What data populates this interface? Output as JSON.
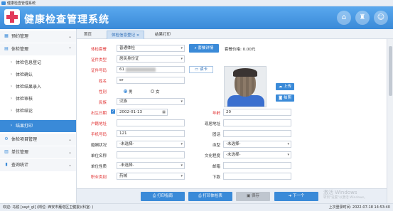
{
  "window": {
    "title": "健康检查管理系统"
  },
  "header": {
    "title": "健康检查管理系统",
    "buttons": [
      "home-icon",
      "shirt-icon",
      "user-icon"
    ]
  },
  "sidebar": {
    "items": [
      {
        "label": "预约管理",
        "level": 0,
        "icon": "calendar-icon"
      },
      {
        "label": "体检管理",
        "level": 0,
        "icon": "clipboard-icon"
      },
      {
        "label": "体检信息登记",
        "level": 1
      },
      {
        "label": "体检确认",
        "level": 1
      },
      {
        "label": "体检结果录入",
        "level": 1
      },
      {
        "label": "体检审核",
        "level": 1
      },
      {
        "label": "体检结论",
        "level": 1
      },
      {
        "label": "结果打印",
        "level": 1,
        "active": true
      },
      {
        "label": "体检项目管理",
        "level": 0,
        "icon": "gear-icon"
      },
      {
        "label": "单位管理",
        "level": 0,
        "icon": "building-icon"
      },
      {
        "label": "查询统计",
        "level": 0,
        "icon": "chart-icon"
      }
    ]
  },
  "tabs": [
    {
      "label": "首页"
    },
    {
      "label": "体检信息登记 ×",
      "active": true
    },
    {
      "label": "结果打印"
    }
  ],
  "form": {
    "package_label": "体检套餐",
    "package_value": "普通体检",
    "package_button": "套餐详情",
    "package_price": "套餐价格: 0.00元",
    "id_type_label": "证件类型",
    "id_type_value": "居民身份证",
    "id_no_label": "证件号码",
    "id_no_value": "61",
    "read_card_button": "读卡",
    "name_label": "姓名",
    "name_value": "er",
    "gender_label": "性别",
    "gender_male": "男",
    "gender_female": "女",
    "ethnicity_label": "民族",
    "ethnicity_value": "汉族",
    "birth_label": "出生日期",
    "birth_value": "2002-01-13",
    "age_label": "年龄",
    "age_value": "20",
    "hukou_label": "户籍地址",
    "hukou_value": "",
    "current_label": "现居地址",
    "current_value": "",
    "phone_label": "手机号码",
    "phone_value": "121",
    "tel_label": "固话",
    "tel_value": "",
    "marital_label": "婚姻状况",
    "marital_value": "-未选择-",
    "blood_label": "血型",
    "blood_value": "-未选择-",
    "company_label": "单位名称",
    "company_value": "",
    "education_label": "文化程度",
    "education_value": "-未选择-",
    "company_type_label": "单位性质",
    "company_type_value": "-未选择-",
    "email_label": "邮箱",
    "email_value": "",
    "occupation_label": "职业类别",
    "occupation_value": "药械",
    "postcode_label": "下款",
    "postcode_value": "",
    "upload_button": "上传",
    "photo_button": "拍照"
  },
  "bottom": {
    "print_guide": "打印指南",
    "print_form": "打印体检表",
    "save": "保存",
    "next": "下一个"
  },
  "watermark": {
    "line1": "激活 Windows",
    "line2": "转到\"设置\"以激活 Windows。"
  },
  "status": {
    "left": "欢迎: 马锐 [sayt_gl] (岗位: 西安市雁塔区卫健委)(科室: )",
    "right": "上次登录时间: 2022-07-18 14:53:40"
  },
  "colors": {
    "accent": "#3a8ad8",
    "required": "#e03030",
    "logo_cross": "#e23a5a"
  }
}
